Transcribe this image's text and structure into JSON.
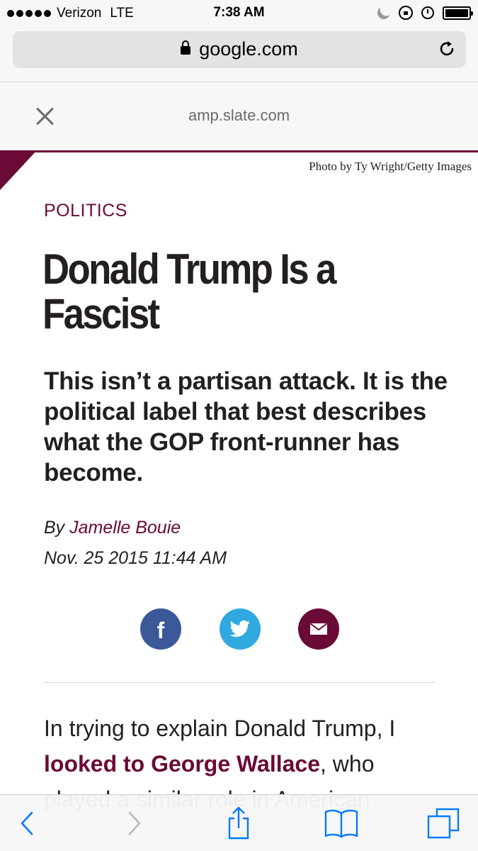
{
  "status_bar": {
    "carrier": "Verizon",
    "network": "LTE",
    "time": "7:38 AM"
  },
  "browser": {
    "url": "google.com"
  },
  "amp_header": {
    "domain": "amp.slate.com"
  },
  "article": {
    "photo_credit": "Photo by Ty Wright/Getty Images",
    "section": "POLITICS",
    "headline": "Donald Trump Is a Fascist",
    "dek": "This isn’t a partisan attack. It is the political label that best describes what the GOP front-runner has become.",
    "byline_prefix": "By",
    "author": "Jamelle Bouie",
    "dateline": "Nov. 25 2015 11:44 AM",
    "body_intro": "In trying to explain Donald Trump, I",
    "body_link": "looked to George Wallace",
    "body_after": ", who",
    "body_cutoff": "played a similar role in American"
  },
  "colors": {
    "brand": "#6a0a36",
    "facebook": "#3b5998",
    "twitter": "#2fa9e0",
    "ios_blue": "#007aff"
  },
  "icons": {
    "share": [
      "facebook-icon",
      "twitter-icon",
      "email-icon"
    ],
    "toolbar": [
      "back-icon",
      "forward-icon",
      "share-icon",
      "bookmarks-icon",
      "tabs-icon"
    ]
  }
}
